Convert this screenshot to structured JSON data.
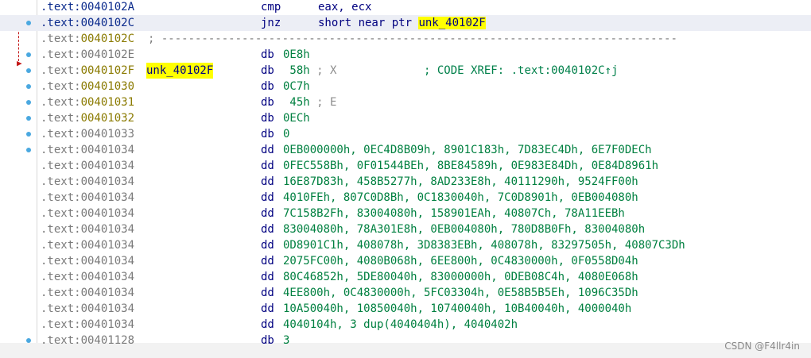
{
  "colors": {
    "dot": "#4aa8e0",
    "name_highlight": "#ffff00",
    "line_highlight": "#eceef5",
    "flow_arrow": "#c41818",
    "operand_data": "#008040",
    "instruction": "#000080"
  },
  "rows": [
    {
      "seg": ".text:",
      "off": "0040102A",
      "name": "",
      "mnem": "cmp",
      "ops": "eax, ecx",
      "comment": "",
      "xref": "",
      "dot": false,
      "style": "code"
    },
    {
      "seg": ".text:",
      "off": "0040102C",
      "name": "",
      "mnem": "jnz",
      "ops": "short near ptr ",
      "ops_target": "unk_40102F",
      "comment": "",
      "xref": "",
      "dot": true,
      "style": "code"
    },
    {
      "seg": ".text:",
      "off": "0040102C",
      "name": "",
      "mnem": "",
      "ops": "",
      "separator": "; -----------------------------------------------------------------------------",
      "comment": "",
      "xref": "",
      "dot": false,
      "style": "code2"
    },
    {
      "seg": ".text:",
      "off": "0040102E",
      "name": "",
      "mnem": "db",
      "ops": "0E8h",
      "comment": "",
      "xref": "",
      "dot": true,
      "style": "data"
    },
    {
      "seg": ".text:",
      "off": "0040102F",
      "name": "unk_40102F",
      "mnem": "db",
      "ops": " 58h",
      "comment": " ; X",
      "xref": "             ; CODE XREF: .text:0040102C↑j",
      "dot": true,
      "style": "code2"
    },
    {
      "seg": ".text:",
      "off": "00401030",
      "name": "",
      "mnem": "db",
      "ops": "0C7h",
      "comment": "",
      "xref": "",
      "dot": true,
      "style": "code2"
    },
    {
      "seg": ".text:",
      "off": "00401031",
      "name": "",
      "mnem": "db",
      "ops": " 45h",
      "comment": " ; E",
      "xref": "",
      "dot": true,
      "style": "code2"
    },
    {
      "seg": ".text:",
      "off": "00401032",
      "name": "",
      "mnem": "db",
      "ops": "0ECh",
      "comment": "",
      "xref": "",
      "dot": true,
      "style": "code2"
    },
    {
      "seg": ".text:",
      "off": "00401033",
      "name": "",
      "mnem": "db",
      "ops": "0",
      "comment": "",
      "xref": "",
      "dot": true,
      "style": "data"
    },
    {
      "seg": ".text:",
      "off": "00401034",
      "name": "",
      "mnem": "dd",
      "ops": "0EB000000h, 0EC4D8B09h, 8901C183h, 7D83EC4Dh, 6E7F0DECh",
      "comment": "",
      "xref": "",
      "dot": true,
      "style": "data"
    },
    {
      "seg": ".text:",
      "off": "00401034",
      "name": "",
      "mnem": "dd",
      "ops": "0FEC558Bh, 0F01544BEh, 8BE84589h, 0E983E84Dh, 0E84D8961h",
      "comment": "",
      "xref": "",
      "dot": false,
      "style": "data"
    },
    {
      "seg": ".text:",
      "off": "00401034",
      "name": "",
      "mnem": "dd",
      "ops": "16E87D83h, 458B5277h, 8AD233E8h, 40111290h, 9524FF00h",
      "comment": "",
      "xref": "",
      "dot": false,
      "style": "data"
    },
    {
      "seg": ".text:",
      "off": "00401034",
      "name": "",
      "mnem": "dd",
      "ops": "4010FEh, 807C0D8Bh, 0C1830040h, 7C0D8901h, 0EB004080h",
      "comment": "",
      "xref": "",
      "dot": false,
      "style": "data"
    },
    {
      "seg": ".text:",
      "off": "00401034",
      "name": "",
      "mnem": "dd",
      "ops": "7C158B2Fh, 83004080h, 158901EAh, 40807Ch, 78A11EEBh",
      "comment": "",
      "xref": "",
      "dot": false,
      "style": "data"
    },
    {
      "seg": ".text:",
      "off": "00401034",
      "name": "",
      "mnem": "dd",
      "ops": "83004080h, 78A301E8h, 0EB004080h, 780D8B0Fh, 83004080h",
      "comment": "",
      "xref": "",
      "dot": false,
      "style": "data"
    },
    {
      "seg": ".text:",
      "off": "00401034",
      "name": "",
      "mnem": "dd",
      "ops": "0D8901C1h, 408078h, 3D8383EBh, 408078h, 83297505h, 40807C3Dh",
      "comment": "",
      "xref": "",
      "dot": false,
      "style": "data"
    },
    {
      "seg": ".text:",
      "off": "00401034",
      "name": "",
      "mnem": "dd",
      "ops": "2075FC00h, 4080B068h, 6EE800h, 0C4830000h, 0F0558D04h",
      "comment": "",
      "xref": "",
      "dot": false,
      "style": "data"
    },
    {
      "seg": ".text:",
      "off": "00401034",
      "name": "",
      "mnem": "dd",
      "ops": "80C46852h, 5DE80040h, 83000000h, 0DEB08C4h, 4080E068h",
      "comment": "",
      "xref": "",
      "dot": false,
      "style": "data"
    },
    {
      "seg": ".text:",
      "off": "00401034",
      "name": "",
      "mnem": "dd",
      "ops": "4EE800h, 0C4830000h, 5FC03304h, 0E58B5B5Eh, 1096C35Dh",
      "comment": "",
      "xref": "",
      "dot": false,
      "style": "data"
    },
    {
      "seg": ".text:",
      "off": "00401034",
      "name": "",
      "mnem": "dd",
      "ops": "10A50040h, 10850040h, 10740040h, 10B40040h, 4000040h",
      "comment": "",
      "xref": "",
      "dot": false,
      "style": "data"
    },
    {
      "seg": ".text:",
      "off": "00401034",
      "name": "",
      "mnem": "dd",
      "ops": "4040104h, 3 dup(4040404h), 4040402h",
      "comment": "",
      "xref": "",
      "dot": false,
      "style": "data"
    },
    {
      "seg": ".text:",
      "off": "00401128",
      "name": "",
      "mnem": "db",
      "ops": "3",
      "comment": "",
      "xref": "",
      "dot": true,
      "style": "data"
    }
  ],
  "watermark": "CSDN @F4llr4in"
}
